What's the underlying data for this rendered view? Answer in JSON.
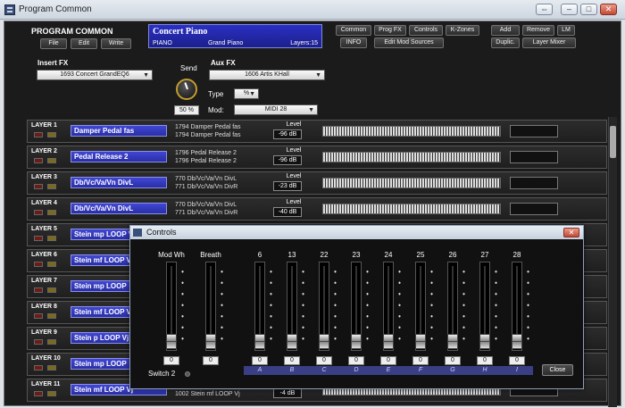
{
  "window": {
    "title": "Program Common"
  },
  "header": {
    "title": "PROGRAM COMMON",
    "buttons": {
      "file": "File",
      "edit": "Edit",
      "write": "Write"
    },
    "program": {
      "name": "Concert Piano",
      "category": "PIANO",
      "type": "Grand Piano",
      "layers": "Layers:15"
    },
    "nav": {
      "common": "Common",
      "prog_fx": "Prog FX",
      "controls": "Controls",
      "k_zones": "K-Zones",
      "info": "INFO",
      "edit_mod": "Edit Mod Sources"
    },
    "actions": {
      "add": "Add",
      "remove": "Remove",
      "lm": "LM",
      "duplic": "Duplic.",
      "layer_mixer": "Layer Mixer"
    }
  },
  "fx": {
    "insert_label": "Insert FX",
    "insert_value": "1693  Concert GrandEQ6",
    "send_label": "Send",
    "send_value": "50 %",
    "aux_label": "Aux FX",
    "aux_value": "1606  Artis KHall",
    "type_label": "Type",
    "type_value": "%",
    "mod_label": "Mod:",
    "mod_value": "MIDI 28"
  },
  "layers": [
    {
      "label": "LAYER 1",
      "program": "Damper Pedal fas",
      "s1": "1794 Damper Pedal fas",
      "s2": "1794 Damper Pedal fas",
      "level_label": "Level",
      "level": "-96 dB"
    },
    {
      "label": "LAYER 2",
      "program": "Pedal Release 2",
      "s1": "1796 Pedal Release 2",
      "s2": "1796 Pedal Release 2",
      "level_label": "Level",
      "level": "-96 dB"
    },
    {
      "label": "LAYER 3",
      "program": "Db/Vc/Va/Vn DivL",
      "s1": "770 Db/Vc/Va/Vn DivL",
      "s2": "771 Db/Vc/Va/Vn DivR",
      "level_label": "Level",
      "level": "-23 dB"
    },
    {
      "label": "LAYER 4",
      "program": "Db/Vc/Va/Vn DivL",
      "s1": "770 Db/Vc/Va/Vn DivL",
      "s2": "771 Db/Vc/Va/Vn DivR",
      "level_label": "Level",
      "level": "-40 dB"
    },
    {
      "label": "LAYER 5",
      "program": "Stein mp LOOP V",
      "s1": "",
      "s2": "",
      "level_label": "",
      "level": ""
    },
    {
      "label": "LAYER 6",
      "program": "Stein mf LOOP V",
      "s1": "",
      "s2": "",
      "level_label": "",
      "level": ""
    },
    {
      "label": "LAYER 7",
      "program": "Stein mp LOOP",
      "s1": "",
      "s2": "",
      "level_label": "",
      "level": ""
    },
    {
      "label": "LAYER 8",
      "program": "Stein mf LOOP V",
      "s1": "",
      "s2": "",
      "level_label": "",
      "level": ""
    },
    {
      "label": "LAYER 9",
      "program": "Stein p LOOP Vj",
      "s1": "",
      "s2": "",
      "level_label": "",
      "level": ""
    },
    {
      "label": "LAYER 10",
      "program": "Stein mp LOOP",
      "s1": "",
      "s2": "",
      "level_label": "",
      "level": ""
    },
    {
      "label": "LAYER 11",
      "program": "Stein mf LOOP Vj",
      "s1": "",
      "s2": "1002 Stein mf LOOP Vj",
      "level_label": "",
      "level": "-4 dB"
    }
  ],
  "controls_dialog": {
    "title": "Controls",
    "close_x": "✕",
    "sliders": [
      {
        "label": "Mod Wh",
        "value": "0",
        "letter": ""
      },
      {
        "label": "Breath",
        "value": "0",
        "letter": ""
      },
      {
        "label": "6",
        "value": "0",
        "letter": "A"
      },
      {
        "label": "13",
        "value": "0",
        "letter": "B"
      },
      {
        "label": "22",
        "value": "0",
        "letter": "C"
      },
      {
        "label": "23",
        "value": "0",
        "letter": "D"
      },
      {
        "label": "24",
        "value": "0",
        "letter": "E"
      },
      {
        "label": "25",
        "value": "0",
        "letter": "F"
      },
      {
        "label": "26",
        "value": "0",
        "letter": "G"
      },
      {
        "label": "27",
        "value": "0",
        "letter": "H"
      },
      {
        "label": "28",
        "value": "0",
        "letter": "I"
      }
    ],
    "switch_label": "Switch 2",
    "close_label": "Close"
  }
}
